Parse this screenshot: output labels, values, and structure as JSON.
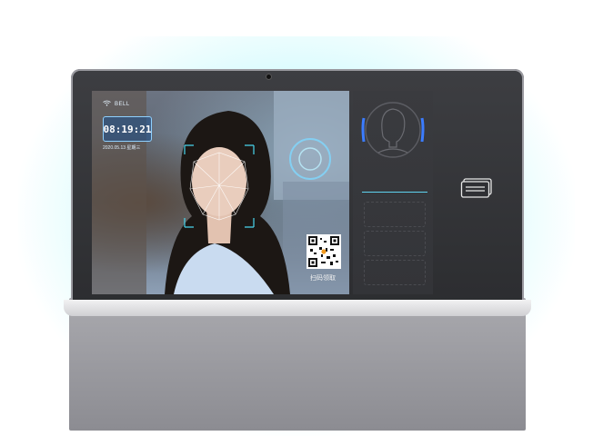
{
  "screen": {
    "status_label": "BELL",
    "clock_time": "08:19:21",
    "date_text": "2020.05.13  星期三",
    "qr_caption": "扫码领取"
  },
  "side_panel": {
    "icons": [
      "face-outline-icon",
      "card-reader-icon"
    ]
  },
  "colors": {
    "accent": "#5fd3f0",
    "bezel": "#2f3034",
    "stand": "#9a9aa0"
  }
}
